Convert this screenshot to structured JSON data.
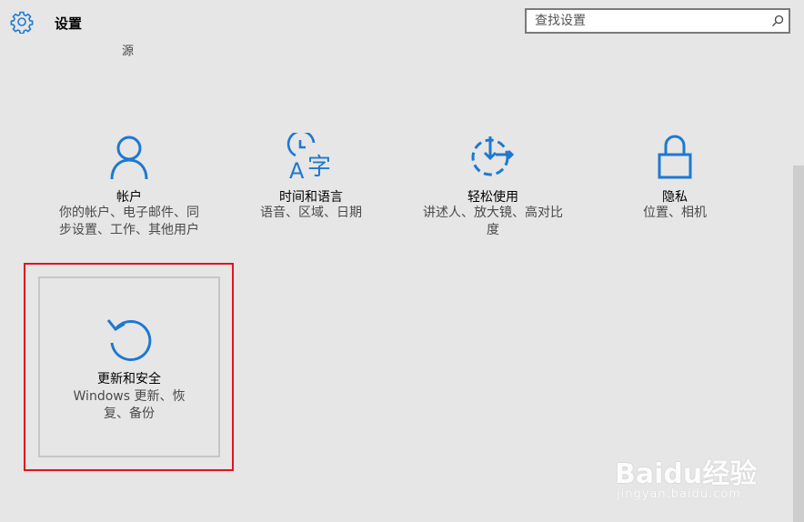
{
  "header": {
    "title": "设置",
    "search_placeholder": "查找设置"
  },
  "stray_text": "源",
  "tiles": [
    {
      "title": "帐户",
      "description": "你的帐户、电子邮件、同步设置、工作、其他用户"
    },
    {
      "title": "时间和语言",
      "description": "语音、区域、日期"
    },
    {
      "title": "轻松使用",
      "description": "讲述人、放大镜、高对比度"
    },
    {
      "title": "隐私",
      "description": "位置、相机"
    },
    {
      "title": "更新和安全",
      "description": "Windows 更新、恢复、备份"
    }
  ],
  "accent_color": "#1e78d2",
  "highlight_color": "#e0141e",
  "watermark": {
    "logo": "Baidu经验",
    "url": "jingyan.baidu.com"
  }
}
